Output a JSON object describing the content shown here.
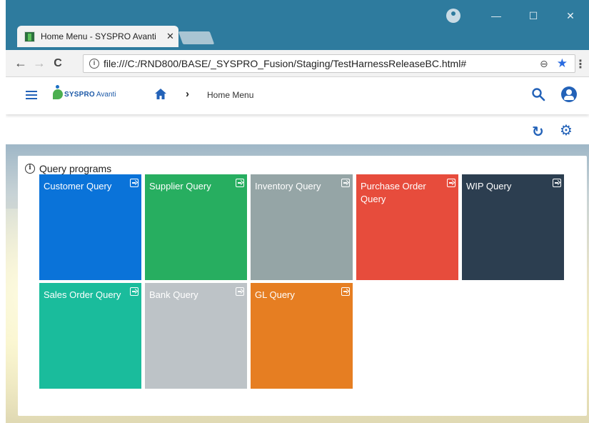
{
  "browser": {
    "tab_title": "Home Menu - SYSPRO Avanti",
    "tab_close": "✕",
    "url": "file:///C:/RND800/BASE/_SYSPRO_Fusion/Staging/TestHarnessReleaseBC.html#",
    "back": "←",
    "forward": "→",
    "reload": "C",
    "info": "i",
    "zoom": "⊖",
    "star": "★",
    "menu": "⋮",
    "minimize": "—",
    "maximize": "☐",
    "close": "✕"
  },
  "app": {
    "logo_text": "SYSPRO",
    "logo_sub": "Avanti",
    "breadcrumb_sep": "›",
    "breadcrumb": "Home Menu",
    "refresh": "↻",
    "settings": "⚙"
  },
  "card": {
    "info": "i",
    "title": "Query programs",
    "tiles": [
      {
        "label": "Customer Query",
        "color": "#0a73d9"
      },
      {
        "label": "Supplier Query",
        "color": "#27ae60"
      },
      {
        "label": "Inventory Query",
        "color": "#95a5a6"
      },
      {
        "label": "Purchase Order Query",
        "color": "#e74c3c"
      },
      {
        "label": "WIP Query",
        "color": "#2c3e50"
      },
      {
        "label": "Sales Order Query",
        "color": "#1abc9c"
      },
      {
        "label": "Bank Query",
        "color": "#bdc3c7"
      },
      {
        "label": "GL Query",
        "color": "#e67e22"
      }
    ]
  }
}
